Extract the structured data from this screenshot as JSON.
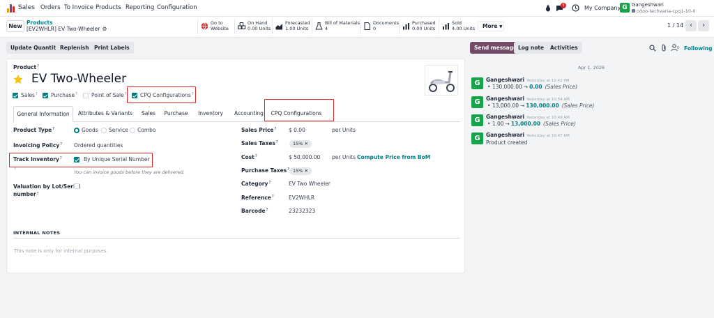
{
  "navbar": {
    "app_name": "Sales",
    "menus": [
      "Orders",
      "To Invoice",
      "Products",
      "Reporting",
      "Configuration"
    ],
    "chat_count": "1",
    "company": "My Company",
    "user_initial": "G",
    "user_name": "Gangeshwari",
    "database": "odoo-techvaria-cpq1-10-0"
  },
  "control_panel": {
    "new_label": "New",
    "breadcrumb_root": "Products",
    "breadcrumb_current": "[EV2WHLR] EV Two-Wheeler",
    "smart_buttons": [
      {
        "line1": "Go to",
        "line2": "Website",
        "icon": "globe-icon"
      },
      {
        "line1": "On Hand",
        "line2": "0.00 Units",
        "icon": "cubes-icon"
      },
      {
        "line1": "Forecasted",
        "line2": "1.00 Units",
        "icon": "chart-area-icon"
      },
      {
        "line1": "Bill of Materials",
        "line2": "4",
        "icon": "flask-icon"
      },
      {
        "line1": "Documents",
        "line2": "0",
        "icon": "file-icon"
      },
      {
        "line1": "Purchased",
        "line2": "0.00 Units",
        "icon": "bar-chart-icon"
      },
      {
        "line1": "Sold",
        "line2": "4.00 Units",
        "icon": "bar-chart-icon"
      }
    ],
    "more_label": "More",
    "pager": "1 / 14"
  },
  "actions": {
    "buttons": [
      "Update Quantity",
      "Replenish",
      "Print Labels"
    ]
  },
  "chatter_actions": {
    "send_message": "Send message",
    "log_note": "Log note",
    "activities": "Activities",
    "following": "Following"
  },
  "form": {
    "product_label": "Product",
    "product_name": "EV Two-Wheeler",
    "checkboxes": [
      {
        "label": "Sales",
        "checked": true
      },
      {
        "label": "Purchase",
        "checked": true
      },
      {
        "label": "Point of Sale",
        "checked": false
      },
      {
        "label": "CPQ Configurations",
        "checked": true
      }
    ],
    "tabs": [
      "General Information",
      "Attributes & Variants",
      "Sales",
      "Purchase",
      "Inventory",
      "Accounting",
      "CPQ Configurations"
    ],
    "product_type": {
      "label": "Product Type",
      "options": [
        "Goods",
        "Service",
        "Combo"
      ],
      "selected": "Goods"
    },
    "invoicing_policy": {
      "label": "Invoicing Policy",
      "value": "Ordered quantities"
    },
    "track_inventory": {
      "label": "Track Inventory",
      "value": "By Unique Serial Number"
    },
    "invoice_hint": "You can invoice goods before they are delivered.",
    "valuation": {
      "label_line1": "Valuation by Lot/Serial",
      "label_line2": "number"
    },
    "sales_price": {
      "label": "Sales Price",
      "value": "$ 0.00",
      "unit": "per Units"
    },
    "sales_taxes": {
      "label": "Sales Taxes",
      "tag": "15%"
    },
    "cost": {
      "label": "Cost",
      "value": "$ 50,000.00",
      "unit": "per Units",
      "link": "Compute Price from BoM"
    },
    "purchase_taxes": {
      "label": "Purchase Taxes",
      "tag": "15%"
    },
    "category": {
      "label": "Category",
      "value": "EV Two Wheeler"
    },
    "reference": {
      "label": "Reference",
      "value": "EV2WHLR"
    },
    "barcode": {
      "label": "Barcode",
      "value": "23232323"
    },
    "internal_notes_title": "INTERNAL NOTES",
    "internal_notes_placeholder": "This note is only for internal purposes."
  },
  "chatter": {
    "date": "Apr 1, 2026",
    "messages": [
      {
        "author": "Gangeshwari",
        "time": "Yesterday at 12:42 PM",
        "old": "130,000.00",
        "new": "0.00",
        "field": "(Sales Price)"
      },
      {
        "author": "Gangeshwari",
        "time": "Yesterday at 10:54 AM",
        "old": "13,000.00",
        "new": "130,000.00",
        "field": "(Sales Price)"
      },
      {
        "author": "Gangeshwari",
        "time": "Yesterday at 10:49 AM",
        "old": "1.00",
        "new": "13,000.00",
        "field": "(Sales Price)"
      },
      {
        "author": "Gangeshwari",
        "time": "Yesterday at 10:47 AM",
        "text": "Product created"
      }
    ]
  },
  "colors": {
    "brand": "#714b67",
    "accent": "#017e84",
    "highlight": "#dc2626",
    "avatar": "#16a34a"
  }
}
